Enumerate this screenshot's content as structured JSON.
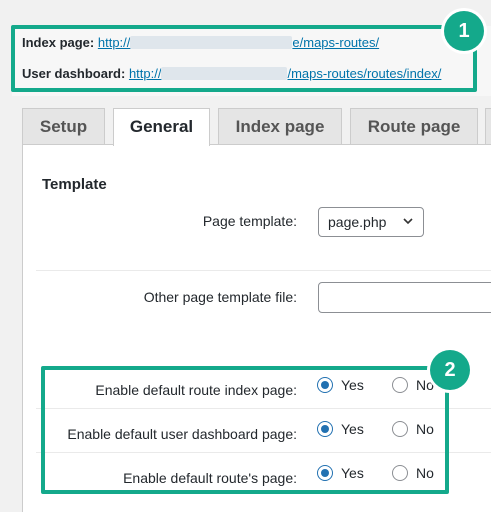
{
  "links": {
    "index_label": "Index page:",
    "index_url_prefix": "http://",
    "index_url_suffix": "e/maps-routes/",
    "dashboard_label": "User dashboard:",
    "dashboard_url_prefix": "http://",
    "dashboard_url_suffix": "/maps-routes/routes/index/"
  },
  "callouts": [
    "1",
    "2"
  ],
  "tabs": [
    "Setup",
    "General",
    "Index page",
    "Route page"
  ],
  "active_tab": "General",
  "template": {
    "title": "Template",
    "page_template_label": "Page template:",
    "page_template_value": "page.php",
    "other_template_label": "Other page template file:",
    "other_template_value": ""
  },
  "options": [
    {
      "label": "Enable default route index page:",
      "yes": "Yes",
      "no": "No",
      "selected": "Yes"
    },
    {
      "label": "Enable default user dashboard page:",
      "yes": "Yes",
      "no": "No",
      "selected": "Yes"
    },
    {
      "label": "Enable default route's page:",
      "yes": "Yes",
      "no": "No",
      "selected": "Yes"
    }
  ],
  "colors": {
    "accent": "#14a98b",
    "link": "#0073aa",
    "radio": "#2271b1"
  }
}
